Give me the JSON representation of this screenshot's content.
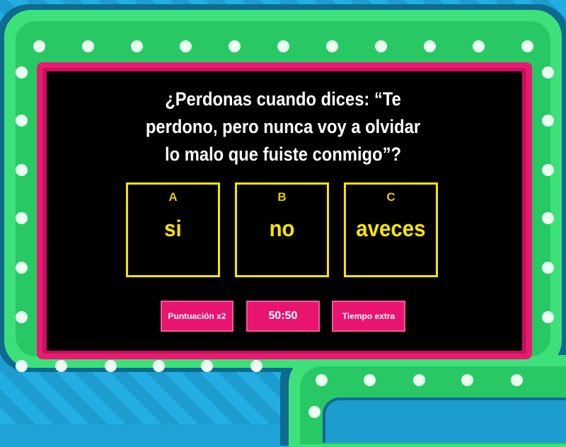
{
  "question": "¿Perdonas cuando dices: “Te\nperdono, pero nunca voy a olvidar\nlo malo que fuiste conmigo”?",
  "answers": [
    {
      "letter": "A",
      "text": "si"
    },
    {
      "letter": "B",
      "text": "no"
    },
    {
      "letter": "C",
      "text": "aveces"
    }
  ],
  "powerups": [
    {
      "label": "Puntuación x2"
    },
    {
      "label": "50:50"
    },
    {
      "label": "Tiempo extra"
    }
  ],
  "colors": {
    "frame_green": "#3ee07a",
    "panel_pink": "#ea1a73",
    "answer_yellow": "#f5e600",
    "screen": "#000000"
  }
}
